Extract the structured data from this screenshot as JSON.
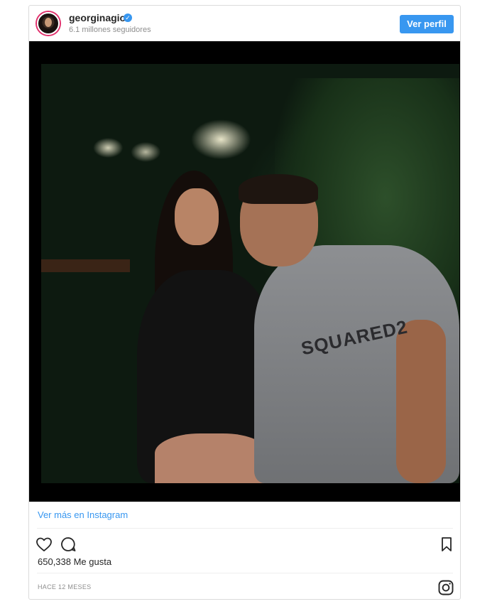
{
  "header": {
    "username": "georginagio",
    "verified_icon": "verified-check-icon",
    "followers": "6.1 millones seguidores",
    "view_profile_label": "Ver perfil"
  },
  "media": {
    "shirt_print": "SQUARED2"
  },
  "footer": {
    "view_more_label": "Ver más en Instagram",
    "likes": "650,338 Me gusta",
    "timestamp": "HACE 12 MESES"
  },
  "icons": {
    "like": "heart-icon",
    "comment": "comment-icon",
    "save": "bookmark-icon",
    "instagram": "instagram-logo-icon"
  },
  "colors": {
    "accent": "#3897f0",
    "text": "#262626",
    "muted": "#8e8e8e"
  }
}
